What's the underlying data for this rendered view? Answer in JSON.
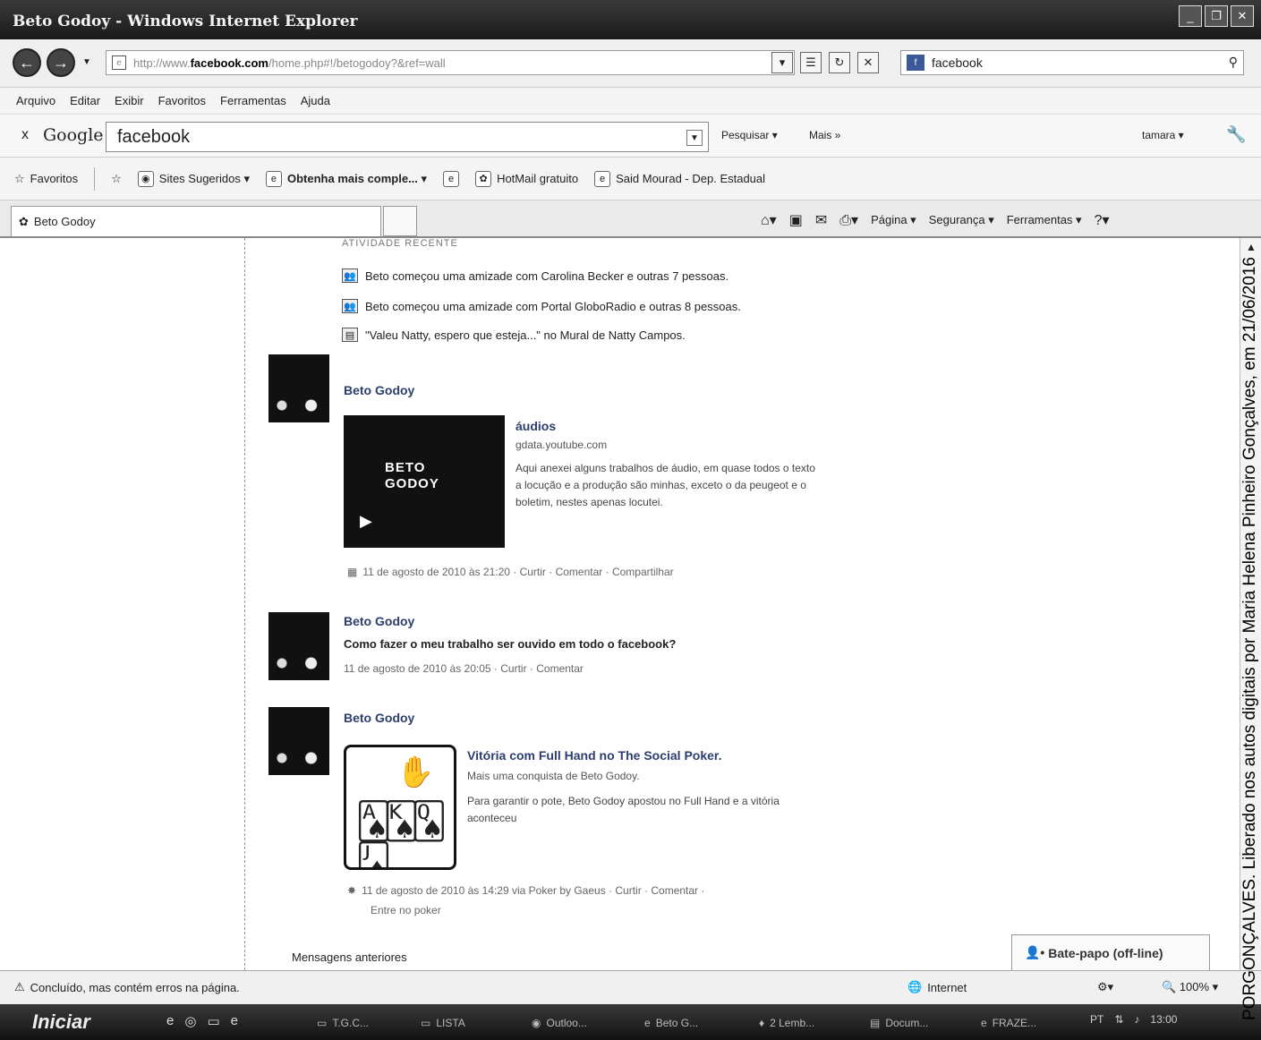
{
  "window": {
    "title": "Beto Godoy - Windows Internet Explorer",
    "buttons": [
      "_",
      "❐",
      "✕"
    ]
  },
  "address": {
    "url_prefix": "http://www.",
    "url_host": "facebook.com",
    "url_rest": "/home.php#!/betogodoy?&ref=wall",
    "search_value": "facebook"
  },
  "menu": [
    "Arquivo",
    "Editar",
    "Exibir",
    "Favoritos",
    "Ferramentas",
    "Ajuda"
  ],
  "google": {
    "close": "x",
    "logo": "Google",
    "query": "facebook",
    "search_label": "Pesquisar ▾",
    "more_label": "Mais »",
    "user_label": "tamara ▾"
  },
  "favorites": {
    "label": "Favoritos",
    "items": [
      "Sites Sugeridos ▾",
      "Obtenha mais comple... ▾",
      "HotMail gratuito",
      "Said Mourad - Dep. Estadual"
    ]
  },
  "tab": {
    "title": "Beto Godoy"
  },
  "commands": [
    "Página ▾",
    "Segurança ▾",
    "Ferramentas ▾"
  ],
  "feed": {
    "recent_head": "ATIVIDADE RECENTE",
    "activities": [
      "Beto começou uma amizade com Carolina Becker e outras 7 pessoas.",
      "Beto começou uma amizade com Portal GloboRadio e outras 8 pessoas.",
      "\"Valeu Natty, espero que esteja...\" no Mural de Natty Campos."
    ],
    "posts": [
      {
        "author": "Beto Godoy",
        "attachment_title": "áudios",
        "attachment_source": "gdata.youtube.com",
        "attachment_desc": "Aqui anexei alguns trabalhos de áudio, em quase todos o texto a locução e a produção são minhas, exceto o da peugeot e o boletim, nestes apenas locutei.",
        "thumb_label_1": "BETO",
        "thumb_label_2": "GODOY",
        "meta": "11 de agosto de 2010 às 21:20 · Curtir · Comentar · Compartilhar"
      },
      {
        "author": "Beto Godoy",
        "text": "Como fazer o meu trabalho ser ouvido em todo o facebook?",
        "meta": "11 de agosto de 2010 às 20:05 · Curtir · Comentar"
      },
      {
        "author": "Beto Godoy",
        "attachment_title": "Vitória com Full Hand no The Social Poker.",
        "attachment_source": "Mais uma conquista de Beto Godoy.",
        "attachment_desc": "Para garantir o pote, Beto Godoy apostou no Full Hand e a vitória aconteceu",
        "meta": "11 de agosto de 2010 às 14:29 via Poker by Gaeus · Curtir · Comentar ·",
        "meta_2": "Entre no poker"
      }
    ],
    "older": "Mensagens anteriores",
    "chat": "Bate-papo (off-line)"
  },
  "status": {
    "text": "Concluído, mas contém erros na página.",
    "zone": "Internet",
    "zoom": "100%"
  },
  "taskbar": {
    "start": "Iniciar",
    "tasks": [
      "T.G.C...",
      "LISTA",
      "Outloo...",
      "Beto G...",
      "2 Lemb...",
      "Docum...",
      "FRAZE..."
    ],
    "lang": "PT",
    "clock": "13:00"
  },
  "watermark": "PORGONÇALVES. Liberado nos autos digitais por Maria Helena Pinheiro Gonçalves, em 21/06/2016"
}
